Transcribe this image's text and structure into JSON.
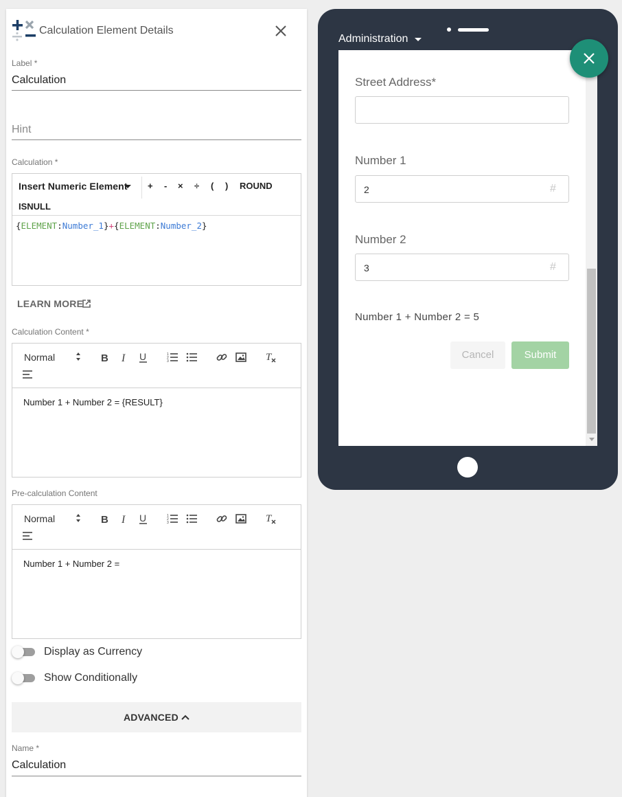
{
  "panel": {
    "title": "Calculation Element Details",
    "label_field": {
      "label": "Label *",
      "value": "Calculation"
    },
    "hint_field": {
      "placeholder": "Hint"
    },
    "calculation": {
      "label": "Calculation *",
      "insert_button": "Insert Numeric Element",
      "operators": [
        "+",
        "-",
        "×",
        "÷",
        "(",
        ")",
        "ROUND",
        "ISNULL"
      ],
      "expression": {
        "open1": "{",
        "el1": "ELEMENT",
        "colon1": ":",
        "num1": "Number_1",
        "close1": "}",
        "plus": "+",
        "open2": "{",
        "el2": "ELEMENT",
        "colon2": ":",
        "num2": "Number_2",
        "close2": "}"
      }
    },
    "learn_more": "LEARN MORE",
    "calculation_content": {
      "label": "Calculation Content *",
      "format": "Normal",
      "content": "Number 1 + Number 2 = {RESULT}"
    },
    "precalculation_content": {
      "label": "Pre-calculation Content",
      "format": "Normal",
      "content": "Number 1 + Number 2 ="
    },
    "toggles": {
      "currency": {
        "label": "Display as Currency",
        "on": false
      },
      "conditional": {
        "label": "Show Conditionally",
        "on": false
      }
    },
    "advanced": {
      "label": "ADVANCED"
    },
    "name_field": {
      "label": "Name *",
      "value": "Calculation"
    }
  },
  "device": {
    "menu": "Administration",
    "form": {
      "street_label": "Street Address*",
      "street_value": "",
      "number1_label": "Number 1",
      "number1_value": "2",
      "number2_label": "Number 2",
      "number2_value": "3",
      "hash_symbol": "#",
      "result": "Number 1 + Number 2 = 5",
      "cancel": "Cancel",
      "submit": "Submit"
    }
  },
  "icons": {
    "logo": "calculator-logo-icon",
    "close": "close-icon",
    "external": "external-link-icon",
    "fab": "close-icon"
  },
  "colors": {
    "device_frame": "#2d3644",
    "fab": "#1e8f77",
    "submit_disabled": "#a3d3a4",
    "code_element": "#5fa34b",
    "code_number": "#3d7bd6",
    "code_operator": "#d2437a"
  }
}
